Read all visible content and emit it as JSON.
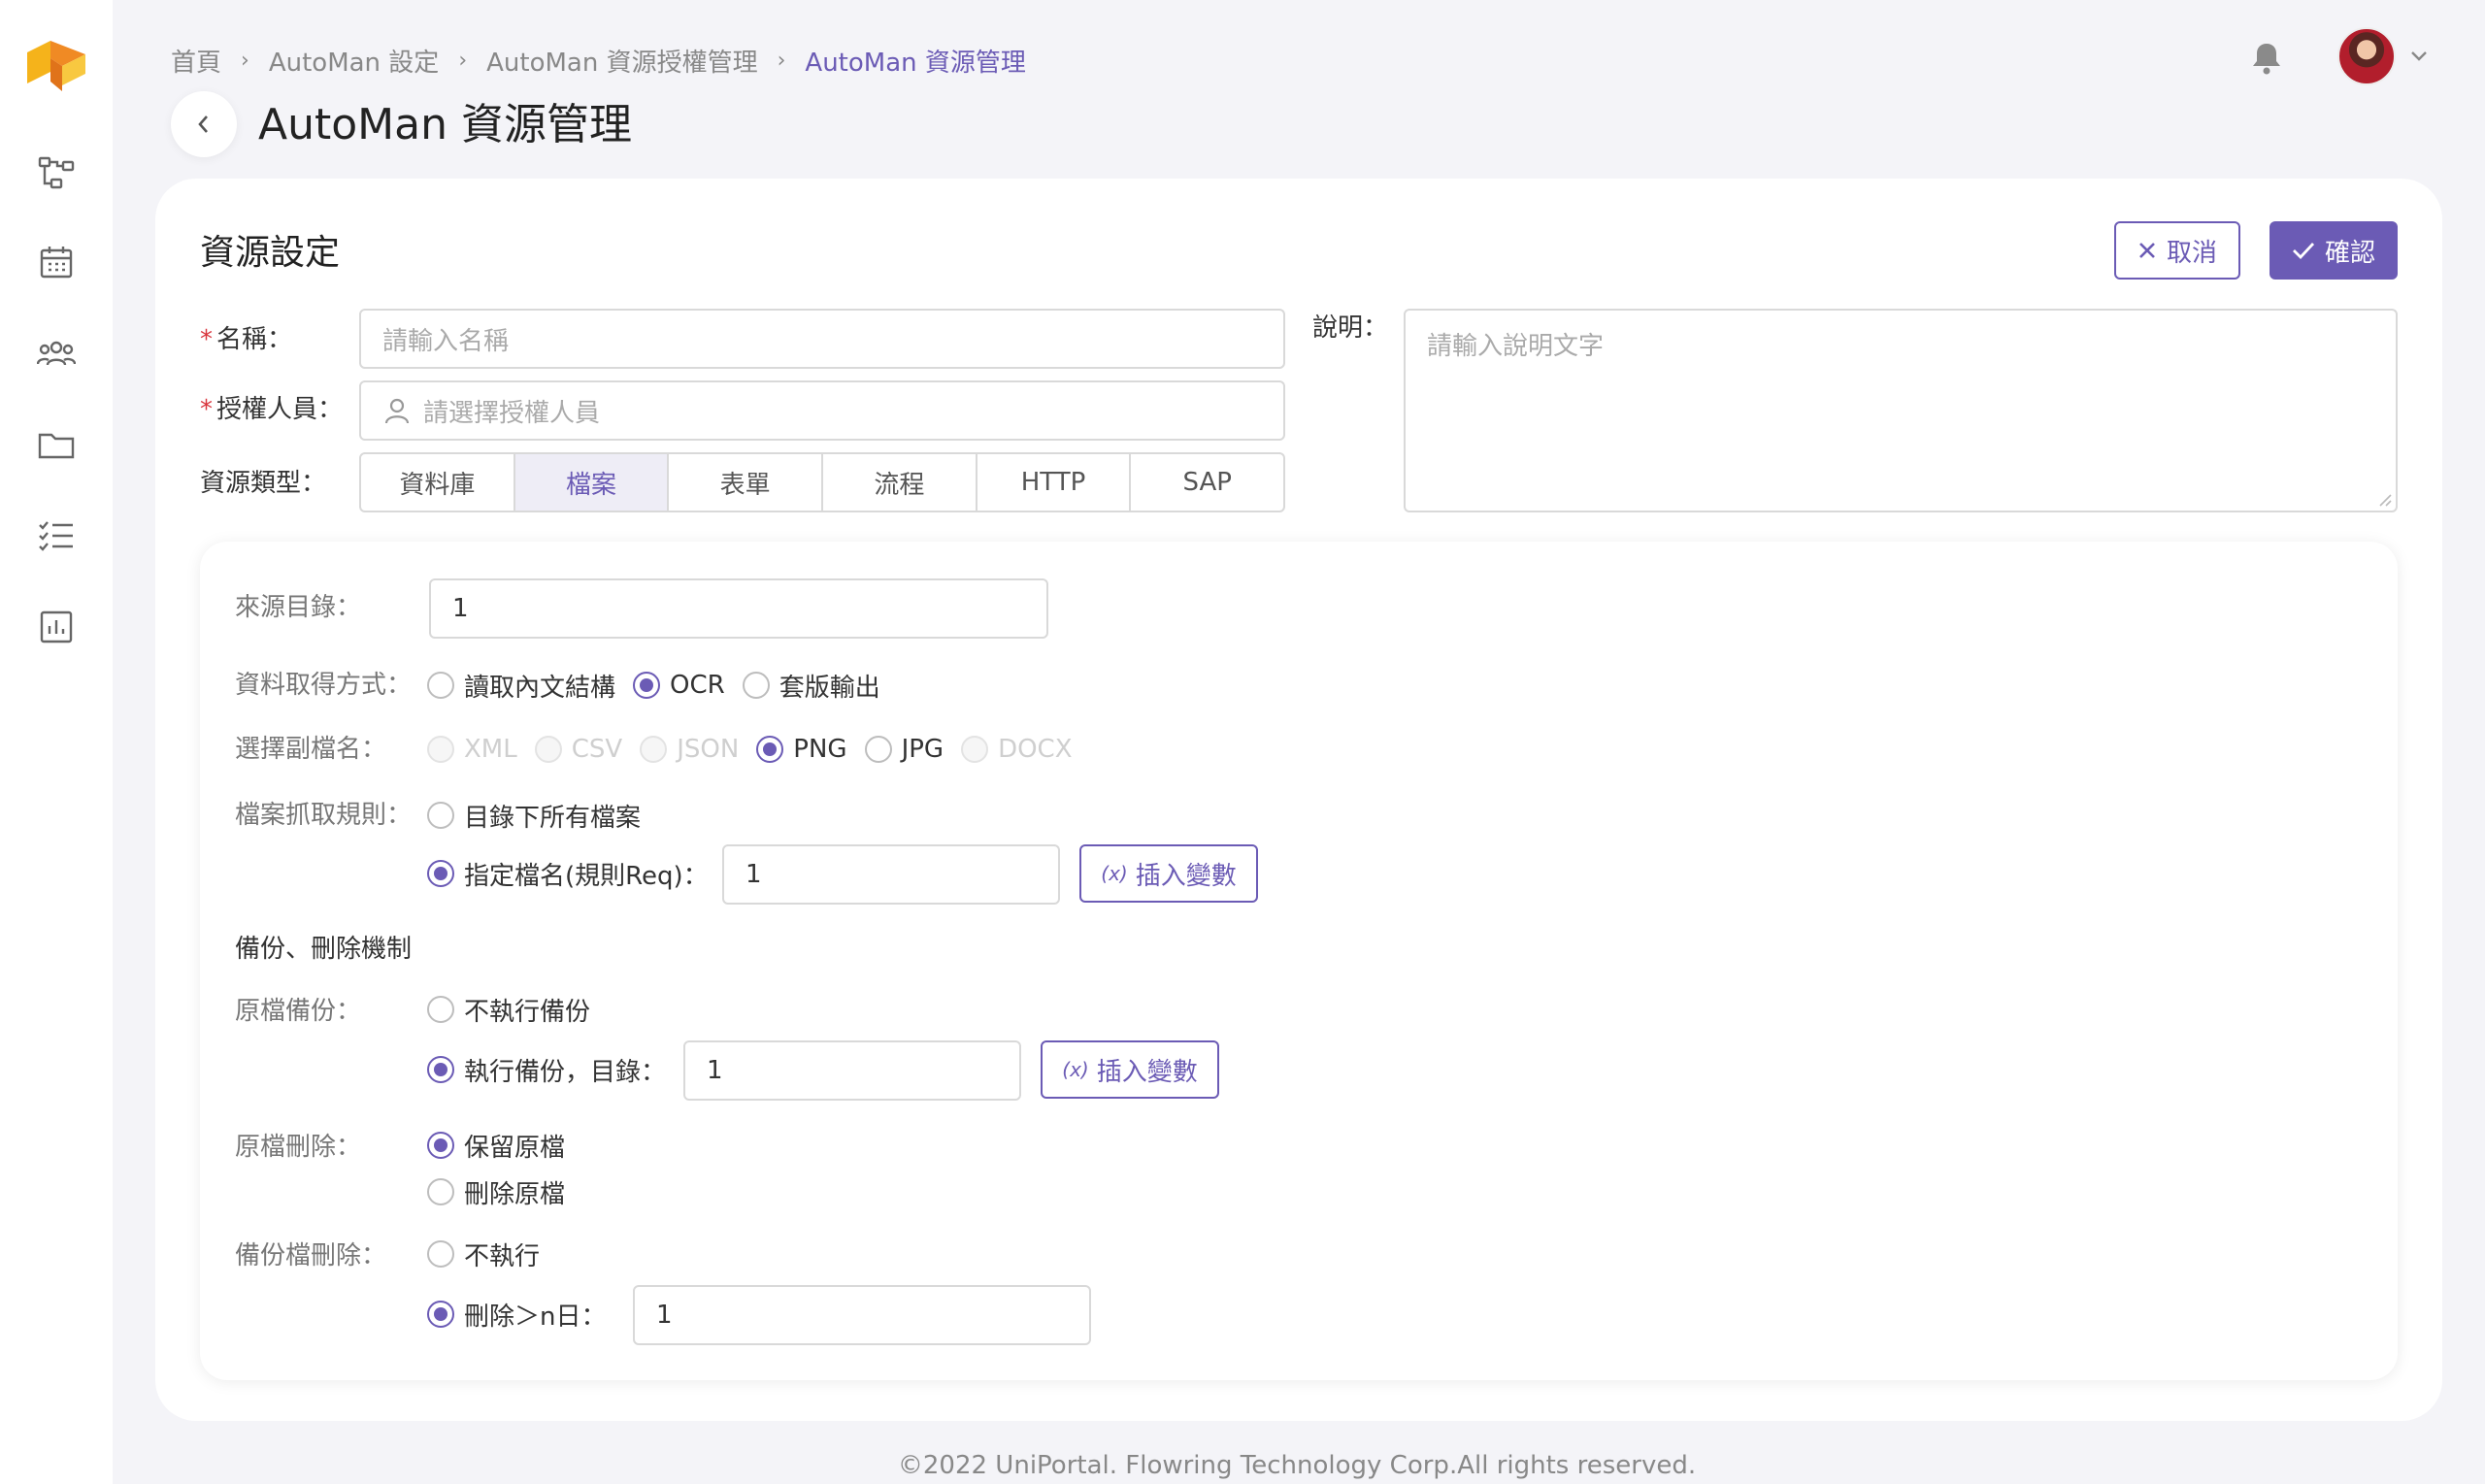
{
  "breadcrumb": {
    "items": [
      "首頁",
      "AutoMan 設定",
      "AutoMan 資源授權管理"
    ],
    "current": "AutoMan 資源管理"
  },
  "page": {
    "title": "AutoMan 資源管理"
  },
  "section": {
    "title": "資源設定"
  },
  "actions": {
    "cancel_label": "取消",
    "confirm_label": "確認"
  },
  "form": {
    "name": {
      "label": "名稱：",
      "placeholder": "請輸入名稱"
    },
    "authorized": {
      "label": "授權人員：",
      "placeholder": "請選擇授權人員"
    },
    "description": {
      "label": "說明：",
      "placeholder": "請輸入說明文字"
    },
    "resource_type": {
      "label": "資源類型：",
      "options": [
        "資料庫",
        "檔案",
        "表單",
        "流程",
        "HTTP",
        "SAP"
      ],
      "selected": "檔案"
    }
  },
  "file": {
    "source_dir": {
      "label": "來源目錄：",
      "value": "1"
    },
    "fetch_method": {
      "label": "資料取得方式：",
      "options": [
        "讀取內文結構",
        "OCR",
        "套版輸出"
      ],
      "selected": "OCR"
    },
    "extension": {
      "label": "選擇副檔名：",
      "options": [
        "XML",
        "CSV",
        "JSON",
        "PNG",
        "JPG",
        "DOCX"
      ],
      "selected": "PNG"
    },
    "fetch_rule": {
      "label": "檔案抓取規則：",
      "option_all": "目錄下所有檔案",
      "option_named": "指定檔名(規則Req)：",
      "named_value": "1",
      "selected": "指定檔名(規則Req)："
    },
    "insert_var_label": "插入變數",
    "insert_var_symbol": "(x)"
  },
  "backup": {
    "heading": "備份、刪除機制",
    "original_backup": {
      "label": "原檔備份：",
      "option_no": "不執行備份",
      "option_yes": "執行備份，目錄：",
      "dir_value": "1",
      "selected": "執行備份，目錄："
    },
    "original_delete": {
      "label": "原檔刪除：",
      "option_keep": "保留原檔",
      "option_delete": "刪除原檔",
      "selected": "保留原檔"
    },
    "backup_delete": {
      "label": "備份檔刪除：",
      "option_no": "不執行",
      "option_days": "刪除＞n日：",
      "days_value": "1",
      "selected": "刪除＞n日："
    }
  },
  "footer": {
    "text": "©2022 UniPortal. Flowring Technology Corp.All rights reserved."
  },
  "colors": {
    "accent": "#6b5bb5",
    "required": "#d9363e",
    "logo_yellow": "#f5b31b",
    "logo_orange": "#f08a24"
  }
}
